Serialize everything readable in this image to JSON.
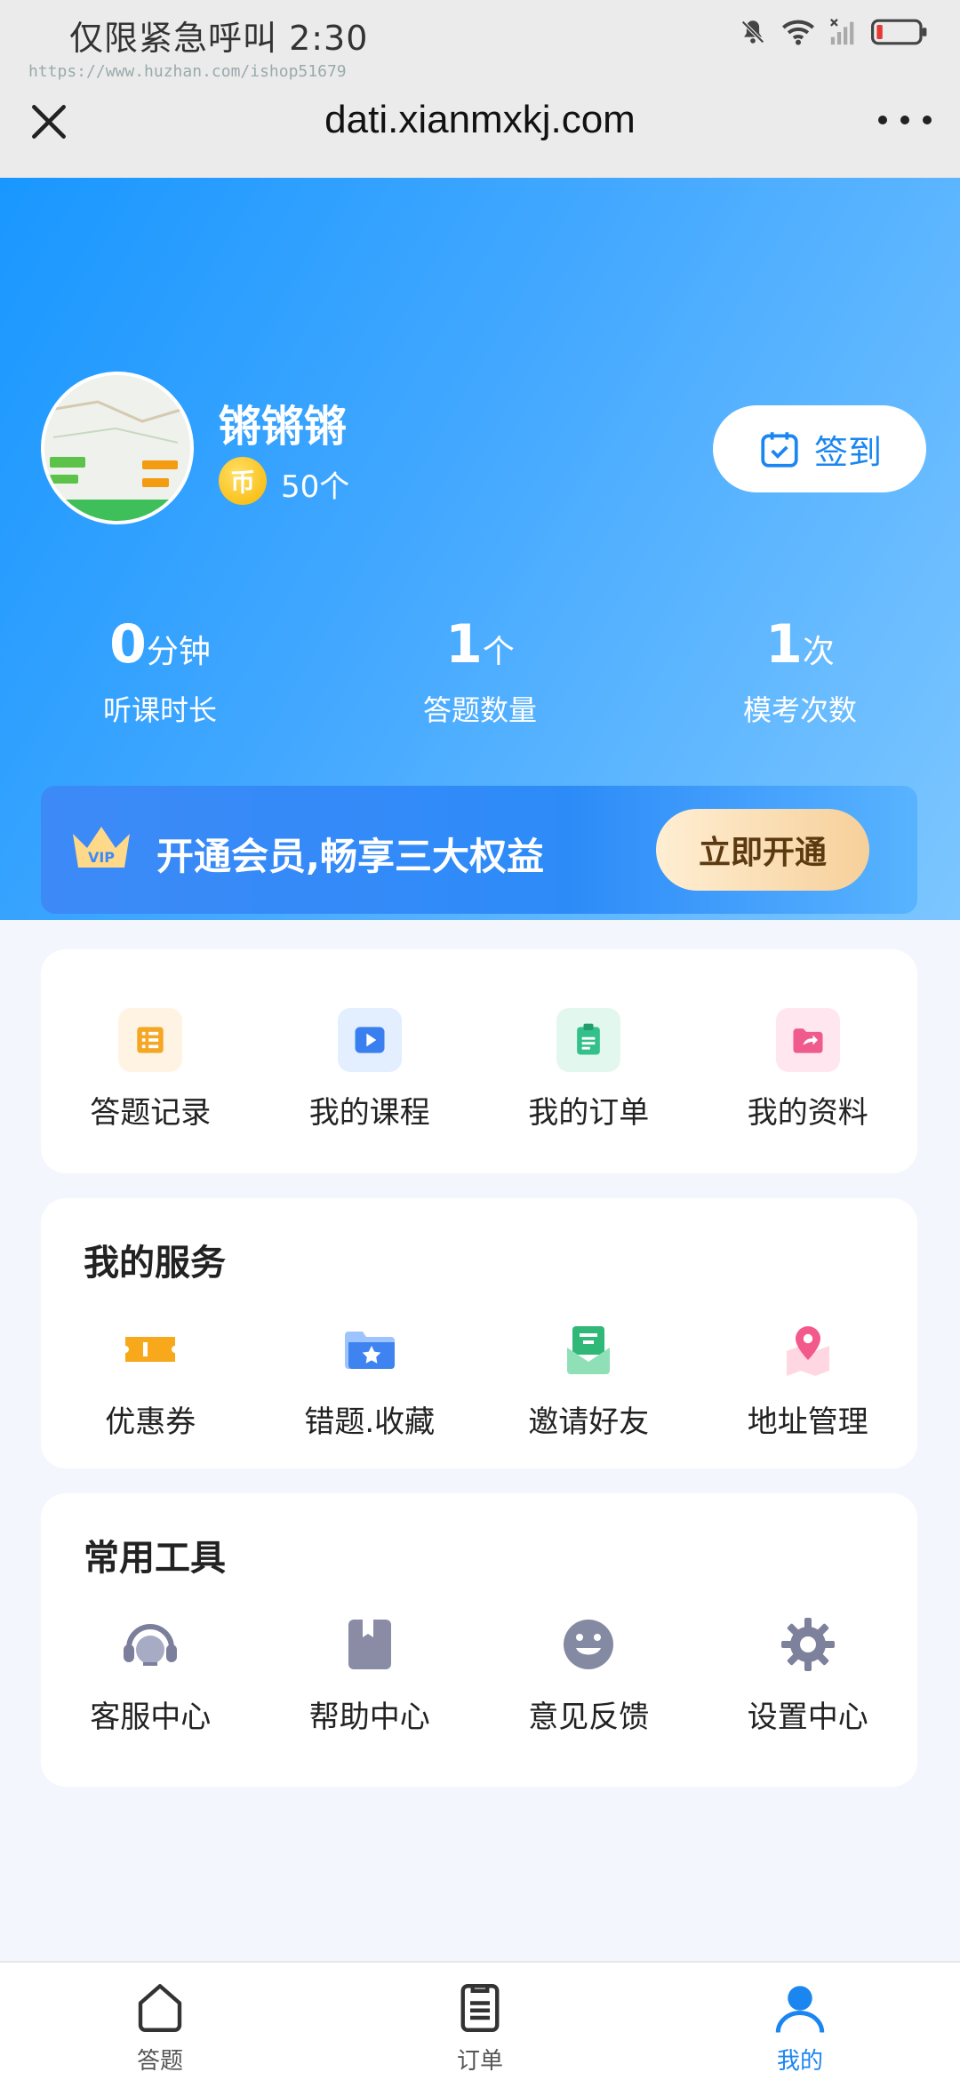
{
  "status_bar": {
    "text": "仅限紧急呼叫 2:30",
    "watermark": "https://www.huzhan.com/ishop51679"
  },
  "browser": {
    "url": "dati.xianmxkj.com"
  },
  "profile": {
    "name": "锵锵锵",
    "coin_symbol": "币",
    "coins": "50个",
    "signin_label": "签到"
  },
  "stats": [
    {
      "value": "0",
      "unit": "分钟",
      "label": "听课时长"
    },
    {
      "value": "1",
      "unit": "个",
      "label": "答题数量"
    },
    {
      "value": "1",
      "unit": "次",
      "label": "模考次数"
    }
  ],
  "vip": {
    "badge": "VIP",
    "text": "开通会员,畅享三大权益",
    "button": "立即开通"
  },
  "shortcuts": [
    {
      "label": "答题记录",
      "icon": "list-icon"
    },
    {
      "label": "我的课程",
      "icon": "video-play-icon"
    },
    {
      "label": "我的订单",
      "icon": "clipboard-icon"
    },
    {
      "label": "我的资料",
      "icon": "folder-share-icon"
    }
  ],
  "services": {
    "title": "我的服务",
    "items": [
      {
        "label": "优惠券",
        "icon": "coupon-icon"
      },
      {
        "label": "错题.收藏",
        "icon": "star-folder-icon"
      },
      {
        "label": "邀请好友",
        "icon": "invite-envelope-icon"
      },
      {
        "label": "地址管理",
        "icon": "location-pin-icon"
      }
    ]
  },
  "tools": {
    "title": "常用工具",
    "items": [
      {
        "label": "客服中心",
        "icon": "headset-icon"
      },
      {
        "label": "帮助中心",
        "icon": "book-icon"
      },
      {
        "label": "意见反馈",
        "icon": "smile-icon"
      },
      {
        "label": "设置中心",
        "icon": "gear-icon"
      }
    ]
  },
  "tabbar": {
    "items": [
      {
        "label": "答题",
        "icon": "home-icon",
        "active": false
      },
      {
        "label": "订单",
        "icon": "order-list-icon",
        "active": false
      },
      {
        "label": "我的",
        "icon": "user-icon",
        "active": true
      }
    ]
  },
  "colors": {
    "primary": "#1b86f0",
    "hero_start": "#1997ff",
    "hero_end": "#7cc6ff"
  }
}
